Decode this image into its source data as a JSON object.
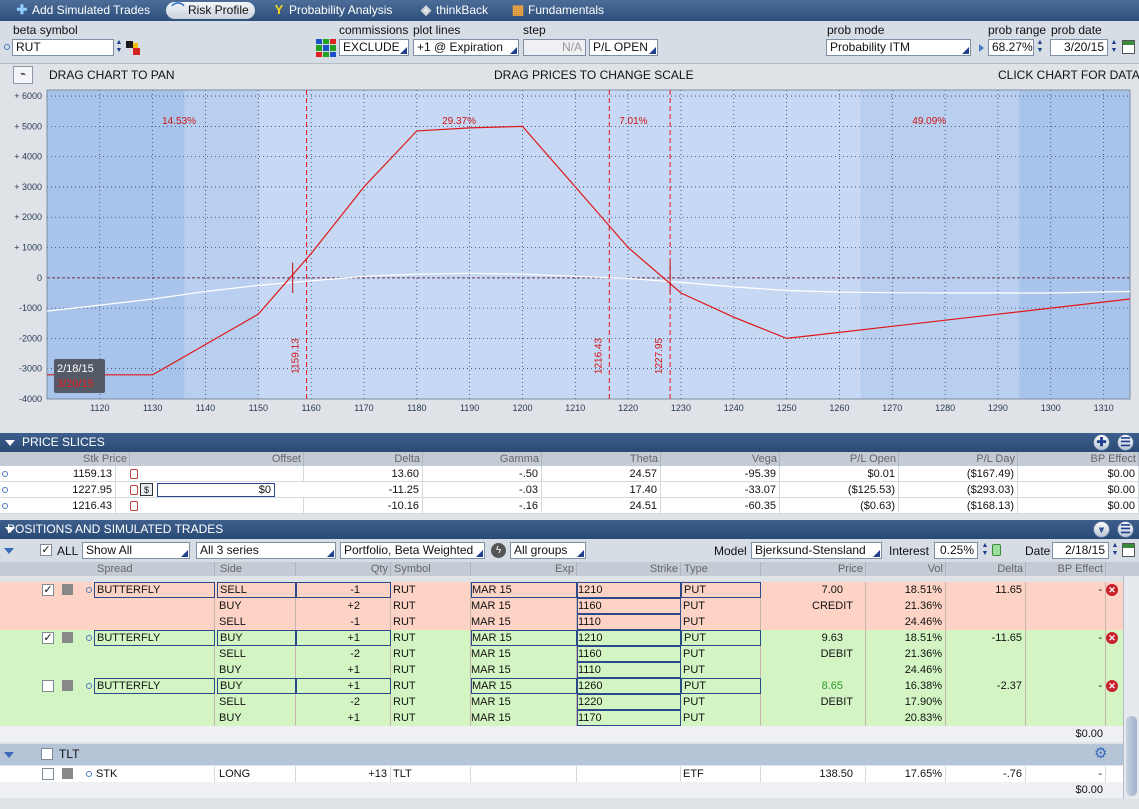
{
  "tabs": [
    {
      "label": "Add Simulated Trades",
      "icon": "plus-icon",
      "active": false
    },
    {
      "label": "Risk Profile",
      "icon": "risk-profile-icon",
      "active": true
    },
    {
      "label": "Probability Analysis",
      "icon": "probability-icon",
      "active": false
    },
    {
      "label": "thinkBack",
      "icon": "thinkback-icon",
      "active": false
    },
    {
      "label": "Fundamentals",
      "icon": "fundamentals-icon",
      "active": false
    }
  ],
  "controls": {
    "beta_symbol_label": "beta symbol",
    "beta_symbol_value": "RUT",
    "commissions_label": "commissions",
    "commissions_value": "EXCLUDE",
    "plot_lines_label": "plot lines",
    "plot_lines_value": "+1 @ Expiration",
    "step_label": "step",
    "step_value": "N/A",
    "pl_mode_value": "P/L OPEN",
    "prob_mode_label": "prob mode",
    "prob_mode_value": "Probability ITM",
    "prob_range_label": "prob range",
    "prob_range_value": "68.27%",
    "prob_date_label": "prob date",
    "prob_date_value": "3/20/15"
  },
  "chart_bar": {
    "left": "DRAG CHART TO PAN",
    "center": "DRAG PRICES TO CHANGE SCALE",
    "right": "CLICK CHART FOR DATA"
  },
  "chart_data": {
    "type": "line",
    "xlim": [
      1110,
      1315
    ],
    "ylim": [
      -4000,
      6200
    ],
    "x_ticks": [
      1120,
      1130,
      1140,
      1150,
      1160,
      1170,
      1180,
      1190,
      1200,
      1210,
      1220,
      1230,
      1240,
      1250,
      1260,
      1270,
      1280,
      1290,
      1300,
      1310
    ],
    "y_ticks": [
      {
        "v": 6000,
        "label": "+ 6000"
      },
      {
        "v": 5000,
        "label": "+ 5000"
      },
      {
        "v": 4000,
        "label": "+ 4000"
      },
      {
        "v": 3000,
        "label": "+ 3000"
      },
      {
        "v": 2000,
        "label": "+ 2000"
      },
      {
        "v": 1000,
        "label": "+ 1000"
      },
      {
        "v": 0,
        "label": "0"
      },
      {
        "v": -1000,
        "label": "-1000"
      },
      {
        "v": -2000,
        "label": "-2000"
      },
      {
        "v": -3000,
        "label": "-3000"
      },
      {
        "v": -4000,
        "label": "-4000"
      }
    ],
    "grid": true,
    "series": [
      {
        "name": "3/20/15",
        "color": "#e01818",
        "x": [
          1110,
          1130,
          1150,
          1160,
          1170,
          1180,
          1190,
          1200,
          1210,
          1220,
          1230,
          1240,
          1250,
          1260,
          1270,
          1280,
          1290,
          1300,
          1315
        ],
        "y": [
          -3200,
          -3200,
          -1200,
          800,
          3000,
          4850,
          4950,
          5000,
          3000,
          1000,
          -500,
          -1300,
          -2000,
          -1800,
          -1600,
          -1400,
          -1200,
          -1000,
          -700
        ]
      },
      {
        "name": "2/18/15",
        "color": "#ffffff",
        "x": [
          1110,
          1120,
          1130,
          1140,
          1150,
          1160,
          1170,
          1180,
          1190,
          1200,
          1210,
          1220,
          1230,
          1240,
          1250,
          1260,
          1270,
          1280,
          1290,
          1300,
          1315
        ],
        "y": [
          -1100,
          -900,
          -700,
          -450,
          -250,
          -100,
          50,
          120,
          150,
          120,
          50,
          -20,
          -150,
          -300,
          -420,
          -470,
          -490,
          -500,
          -500,
          -500,
          -450
        ]
      }
    ],
    "price_lines": [
      {
        "x": 1159.13,
        "label": "1159.13"
      },
      {
        "x": 1216.43,
        "label": "1216.43"
      },
      {
        "x": 1227.95,
        "label": "1227.95"
      }
    ],
    "prob_labels": [
      {
        "x": 1135,
        "label": "14.53%"
      },
      {
        "x": 1188,
        "label": "29.37%"
      },
      {
        "x": 1221,
        "label": "7.01%"
      },
      {
        "x": 1277,
        "label": "49.09%"
      }
    ],
    "legend": [
      {
        "label": "2/18/15",
        "color": "#ffffff"
      },
      {
        "label": "3/20/15",
        "color": "#e01818"
      }
    ]
  },
  "price_slices": {
    "title": "PRICE SLICES",
    "columns": [
      "Stk Price",
      "Offset",
      "Delta",
      "Gamma",
      "Theta",
      "Vega",
      "P/L Open",
      "P/L Day",
      "BP Effect"
    ],
    "rows": [
      {
        "price": "1159.13",
        "offset": "",
        "delta": "13.60",
        "gamma": "-.50",
        "theta": "24.57",
        "vega": "-95.39",
        "pl_open": "$0.01",
        "pl_day": "($167.49)",
        "bp": "$0.00"
      },
      {
        "price": "1227.95",
        "offset": "$0",
        "delta": "-11.25",
        "gamma": "-.03",
        "theta": "17.40",
        "vega": "-33.07",
        "pl_open": "($125.53)",
        "pl_day": "($293.03)",
        "bp": "$0.00"
      },
      {
        "price": "1216.43",
        "offset": "",
        "delta": "-10.16",
        "gamma": "-.16",
        "theta": "24.51",
        "vega": "-60.35",
        "pl_open": "($0.63)",
        "pl_day": "($168.13)",
        "bp": "$0.00"
      }
    ]
  },
  "positions": {
    "title": "POSITIONS AND SIMULATED TRADES",
    "all_label": "ALL",
    "show_filter": "Show All",
    "series_filter": "All 3 series",
    "weighting": "Portfolio, Beta Weighted",
    "groups": "All groups",
    "model_label": "Model",
    "model_value": "Bjerksund-Stensland",
    "interest_label": "Interest",
    "interest_value": "0.25%",
    "date_label": "Date",
    "date_value": "2/18/15",
    "columns": [
      "Spread",
      "Side",
      "Qty",
      "Symbol",
      "Exp",
      "Strike",
      "Type",
      "Price",
      "Vol",
      "Delta",
      "BP Effect"
    ],
    "groups_list": [
      {
        "color": "pink",
        "checked": true,
        "spread": "BUTTERFLY",
        "price": "7.00",
        "price_type": "CREDIT",
        "delta": "11.65",
        "bp": "-",
        "legs": [
          {
            "side": "SELL",
            "qty": "-1",
            "symbol": "RUT",
            "exp": "MAR 15",
            "strike": "1210",
            "type": "PUT",
            "vol": "18.51%"
          },
          {
            "side": "BUY",
            "qty": "+2",
            "symbol": "RUT",
            "exp": "MAR 15",
            "strike": "1160",
            "type": "PUT",
            "vol": "21.36%"
          },
          {
            "side": "SELL",
            "qty": "-1",
            "symbol": "RUT",
            "exp": "MAR 15",
            "strike": "1110",
            "type": "PUT",
            "vol": "24.46%"
          }
        ]
      },
      {
        "color": "green",
        "checked": true,
        "spread": "BUTTERFLY",
        "price": "9.63",
        "price_type": "DEBIT",
        "delta": "-11.65",
        "bp": "-",
        "legs": [
          {
            "side": "BUY",
            "qty": "+1",
            "symbol": "RUT",
            "exp": "MAR 15",
            "strike": "1210",
            "type": "PUT",
            "vol": "18.51%"
          },
          {
            "side": "SELL",
            "qty": "-2",
            "symbol": "RUT",
            "exp": "MAR 15",
            "strike": "1160",
            "type": "PUT",
            "vol": "21.36%"
          },
          {
            "side": "BUY",
            "qty": "+1",
            "symbol": "RUT",
            "exp": "MAR 15",
            "strike": "1110",
            "type": "PUT",
            "vol": "24.46%"
          }
        ]
      },
      {
        "color": "green",
        "checked": false,
        "spread": "BUTTERFLY",
        "price": "8.65",
        "price_type": "DEBIT",
        "delta": "-2.37",
        "bp": "-",
        "legs": [
          {
            "side": "BUY",
            "qty": "+1",
            "symbol": "RUT",
            "exp": "MAR 15",
            "strike": "1260",
            "type": "PUT",
            "vol": "16.38%"
          },
          {
            "side": "SELL",
            "qty": "-2",
            "symbol": "RUT",
            "exp": "MAR 15",
            "strike": "1220",
            "type": "PUT",
            "vol": "17.90%"
          },
          {
            "side": "BUY",
            "qty": "+1",
            "symbol": "RUT",
            "exp": "MAR 15",
            "strike": "1170",
            "type": "PUT",
            "vol": "20.83%"
          }
        ]
      }
    ],
    "rut_total_bp": "$0.00",
    "tlt_label": "TLT",
    "tlt_row": {
      "spread": "STK",
      "side": "LONG",
      "qty": "+13",
      "symbol": "TLT",
      "type": "ETF",
      "price": "138.50",
      "vol": "17.65%",
      "delta": "-.76",
      "bp": "-"
    },
    "tlt_total_bp": "$0.00"
  }
}
